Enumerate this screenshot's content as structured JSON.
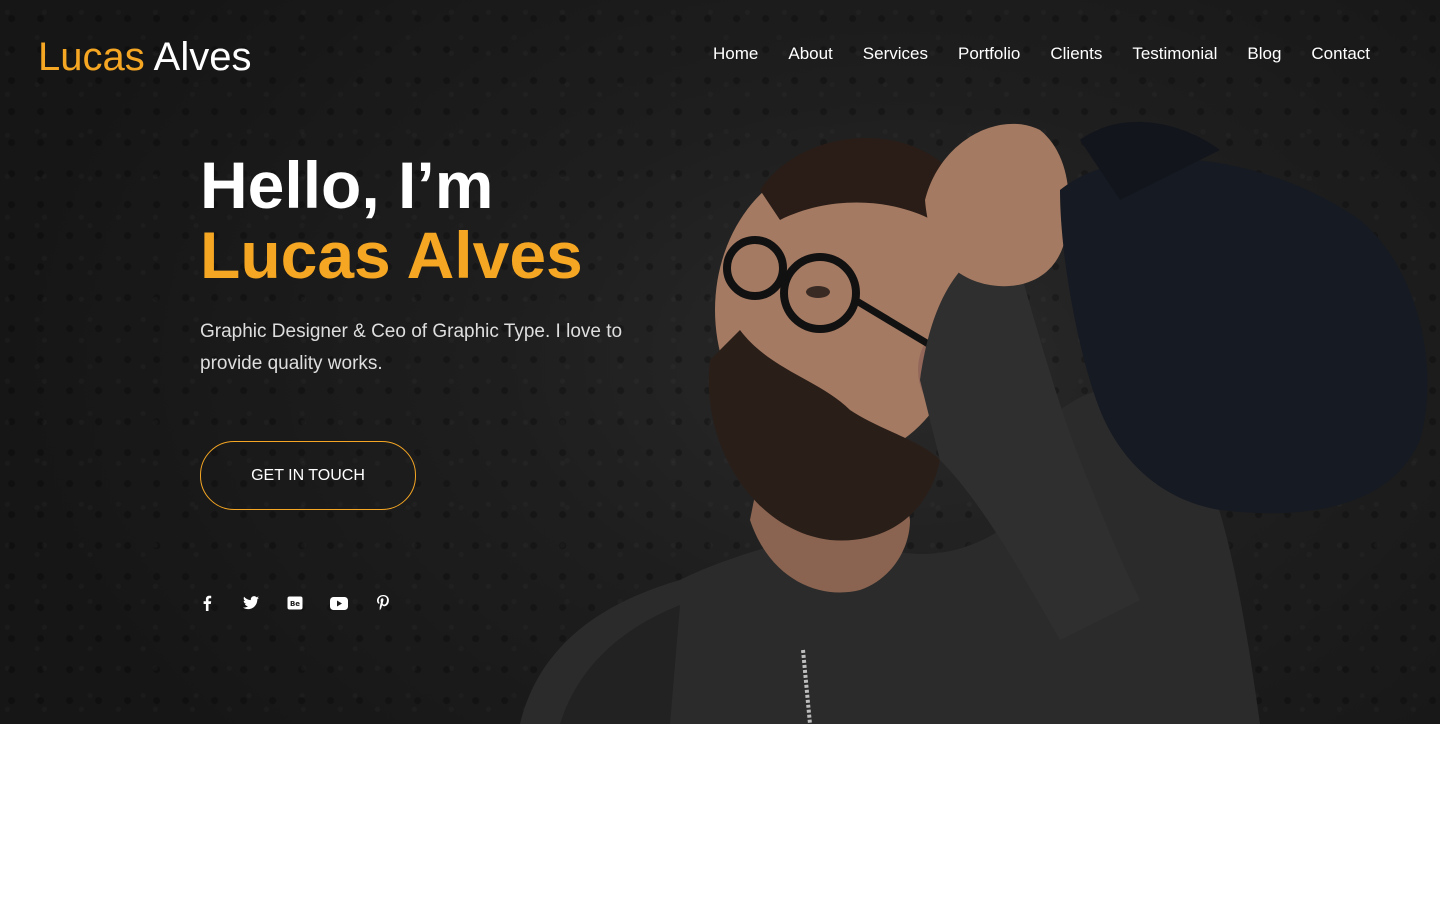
{
  "header": {
    "logo_first": "Lucas",
    "logo_last": "Alves"
  },
  "nav": {
    "items": [
      {
        "label": "Home"
      },
      {
        "label": "About"
      },
      {
        "label": "Services"
      },
      {
        "label": "Portfolio"
      },
      {
        "label": "Clients"
      },
      {
        "label": "Testimonial"
      },
      {
        "label": "Blog"
      },
      {
        "label": "Contact"
      }
    ]
  },
  "hero": {
    "greeting": "Hello, I’m",
    "name": "Lucas Alves",
    "tagline": "Graphic Designer & Ceo of Graphic Type. I love to provide quality works.",
    "cta_label": "GET IN TOUCH"
  },
  "social": {
    "icons": [
      "facebook-icon",
      "twitter-icon",
      "behance-icon",
      "youtube-icon",
      "pinterest-icon"
    ]
  },
  "colors": {
    "accent": "#f5a623",
    "hero_background": "#1c1c1c",
    "text_primary": "#ffffff"
  }
}
